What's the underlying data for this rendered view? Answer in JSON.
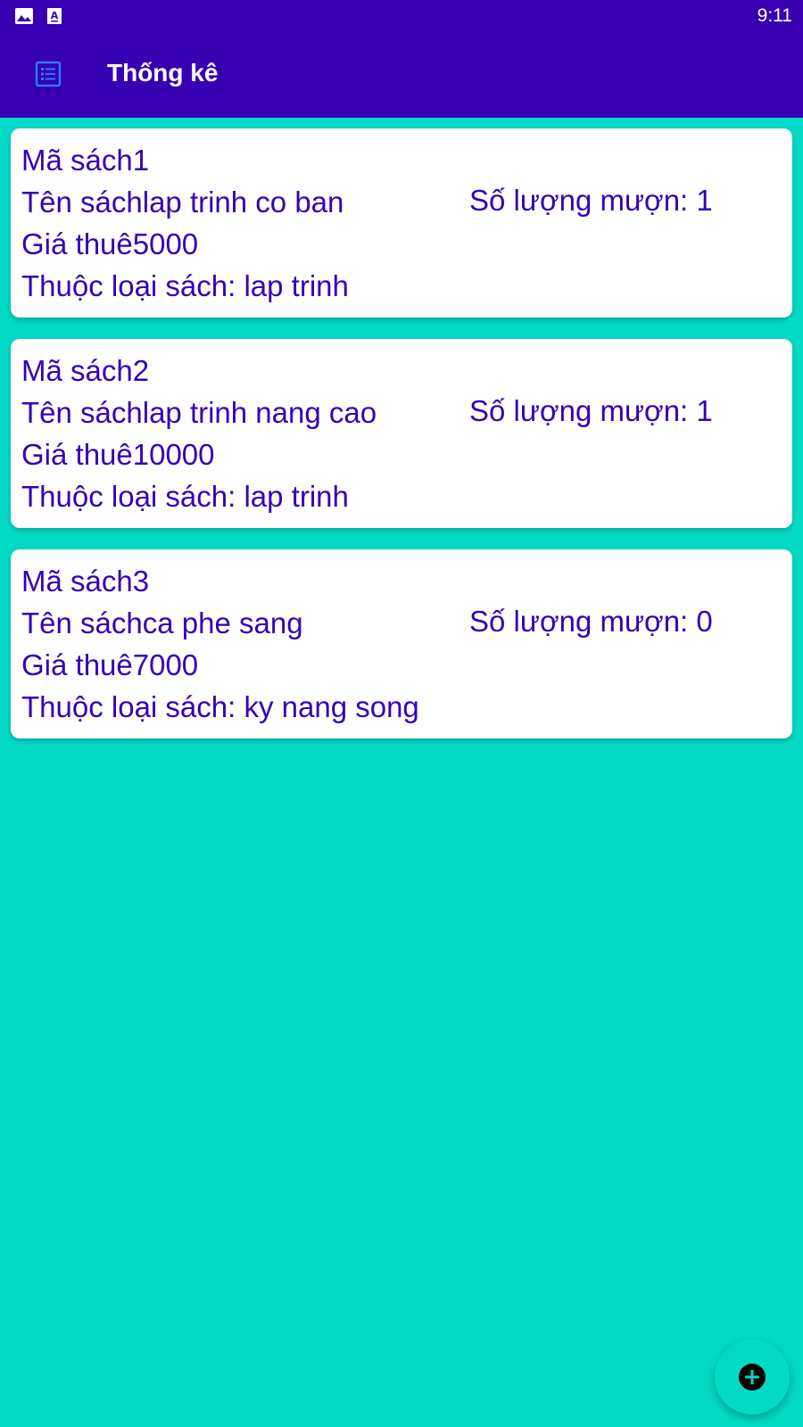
{
  "colors": {
    "primary_dark": "#3700B3",
    "background": "#03DAC5",
    "card_background": "#FFFFFF",
    "text": "#3700B3"
  },
  "status_bar": {
    "time": "9:11",
    "icons": [
      "image-icon",
      "keyboard-icon"
    ]
  },
  "app_bar": {
    "icon": "list-icon",
    "title": "Thống kê"
  },
  "books": [
    {
      "id_text": "Mã sách1",
      "name_text": "Tên sáchlap trinh co ban",
      "price_text": "Giá thuê5000",
      "category_text": "Thuộc loại sách: lap trinh",
      "borrow_count_text": "Số lượng mượn: 1"
    },
    {
      "id_text": "Mã sách2",
      "name_text": "Tên sáchlap trinh nang cao",
      "price_text": "Giá thuê10000",
      "category_text": "Thuộc loại sách: lap trinh",
      "borrow_count_text": "Số lượng mượn: 1"
    },
    {
      "id_text": "Mã sách3",
      "name_text": "Tên sáchca phe sang",
      "price_text": "Giá thuê7000",
      "category_text": "Thuộc loại sách: ky nang song",
      "borrow_count_text": "Số lượng mượn: 0"
    }
  ],
  "fab": {
    "icon": "add-circle-icon"
  }
}
